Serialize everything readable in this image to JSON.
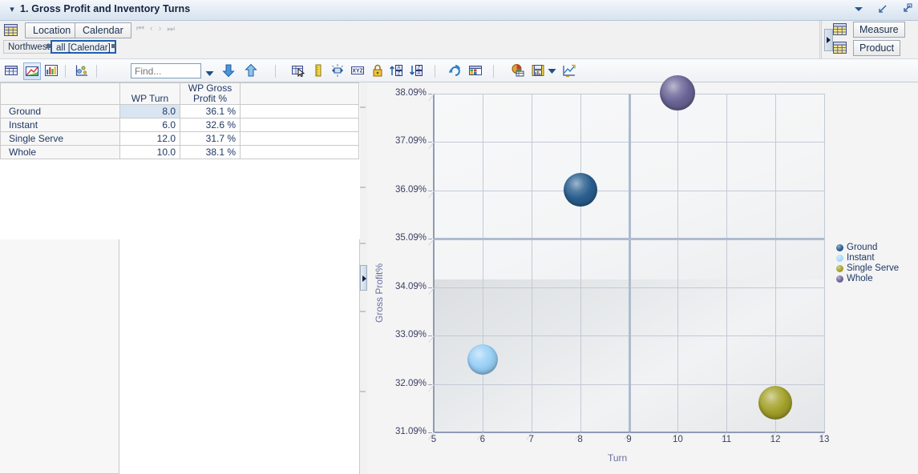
{
  "window": {
    "title": "1. Gross Profit and Inventory Turns",
    "collapse_icon": "chevron-down-icon",
    "controls": [
      {
        "name": "dropdown-arrow-icon",
        "glyph": "▼"
      },
      {
        "name": "restore-down-icon",
        "glyph": "↙"
      },
      {
        "name": "maximize-icon",
        "glyph": "⇱"
      }
    ]
  },
  "dimension_bar": {
    "grid_icon": "grid-icon",
    "buttons": [
      {
        "label": "Location",
        "name": "location-button"
      },
      {
        "label": "Calendar",
        "name": "calendar-button"
      }
    ],
    "pager": [
      "⏮",
      "‹",
      "›",
      "⏭"
    ],
    "chips": [
      {
        "label": "Northwest",
        "name": "filter-chip-northwest",
        "selected": false
      },
      {
        "label": "all [Calendar]",
        "name": "filter-chip-calendar",
        "selected": true
      }
    ]
  },
  "right_panel": {
    "collapse_name": "panel-collapse-handle",
    "rows": [
      {
        "label": "Measure",
        "name": "measure-button",
        "icon": "grid-icon"
      },
      {
        "label": "Product",
        "name": "product-button",
        "icon": "grid-icon"
      }
    ]
  },
  "toolbar": {
    "find": {
      "placeholder": "Find...",
      "value": ""
    },
    "icons": [
      "table-view-icon",
      "chart-view-icon",
      "bar-chart-icon",
      "scatter-chart-icon",
      "select-pointer-icon",
      "ruler-icon",
      "swap-axes-icon",
      "xyz-icon",
      "lock-icon",
      "sort-ascending-icon",
      "sort-descending-icon",
      "refresh-icon",
      "pivot-table-icon",
      "pie-chart-icon",
      "save-chart-icon",
      "dropdown-arrow-icon",
      "trend-chart-icon"
    ]
  },
  "table": {
    "headers": [
      "",
      "WP Turn",
      "WP Gross\nProfit %",
      ""
    ],
    "header_turn": "WP Turn",
    "header_profit_line1": "WP Gross",
    "header_profit_line2": "Profit %",
    "rows": [
      {
        "label": "Ground",
        "turn": "8.0",
        "profit": "36.1 %",
        "selected": true
      },
      {
        "label": "Instant",
        "turn": "6.0",
        "profit": "32.6 %",
        "selected": false
      },
      {
        "label": "Single Serve",
        "turn": "12.0",
        "profit": "31.7 %",
        "selected": false
      },
      {
        "label": "Whole",
        "turn": "10.0",
        "profit": "38.1 %",
        "selected": false
      }
    ]
  },
  "chart_data": {
    "type": "scatter",
    "title": "",
    "xlabel": "Turn",
    "ylabel": "Gross Profit%",
    "xlim": [
      5,
      13
    ],
    "ylim": [
      31.09,
      38.09
    ],
    "xticks": [
      "5",
      "6",
      "7",
      "8",
      "9",
      "10",
      "11",
      "12",
      "13"
    ],
    "xtick_values": [
      5,
      6,
      7,
      8,
      9,
      10,
      11,
      12,
      13
    ],
    "yticks": [
      "31.09%",
      "32.09%",
      "33.09%",
      "34.09%",
      "35.09%",
      "36.09%",
      "37.09%",
      "38.09%"
    ],
    "ytick_values": [
      31.09,
      32.09,
      33.09,
      34.09,
      35.09,
      36.09,
      37.09,
      38.09
    ],
    "grid": true,
    "legend_position": "right",
    "reference_lines": {
      "x": 9,
      "y": 35.09
    },
    "points": [
      {
        "name": "Ground",
        "x": 8,
        "y": 36.1,
        "color": "#2a5f8f",
        "radius": 21
      },
      {
        "name": "Instant",
        "x": 6,
        "y": 32.6,
        "color": "#99d0f7",
        "radius": 19
      },
      {
        "name": "Single Serve",
        "x": 12,
        "y": 31.7,
        "color": "#a4a22b",
        "radius": 21
      },
      {
        "name": "Whole",
        "x": 10,
        "y": 38.1,
        "color": "#6a6596",
        "radius": 22
      }
    ],
    "legend": [
      {
        "label": "Ground",
        "color": "#2a5f8f"
      },
      {
        "label": "Instant",
        "color": "#a8d8f8"
      },
      {
        "label": "Single Serve",
        "color": "#a4a22b"
      },
      {
        "label": "Whole",
        "color": "#6a6596"
      }
    ]
  }
}
